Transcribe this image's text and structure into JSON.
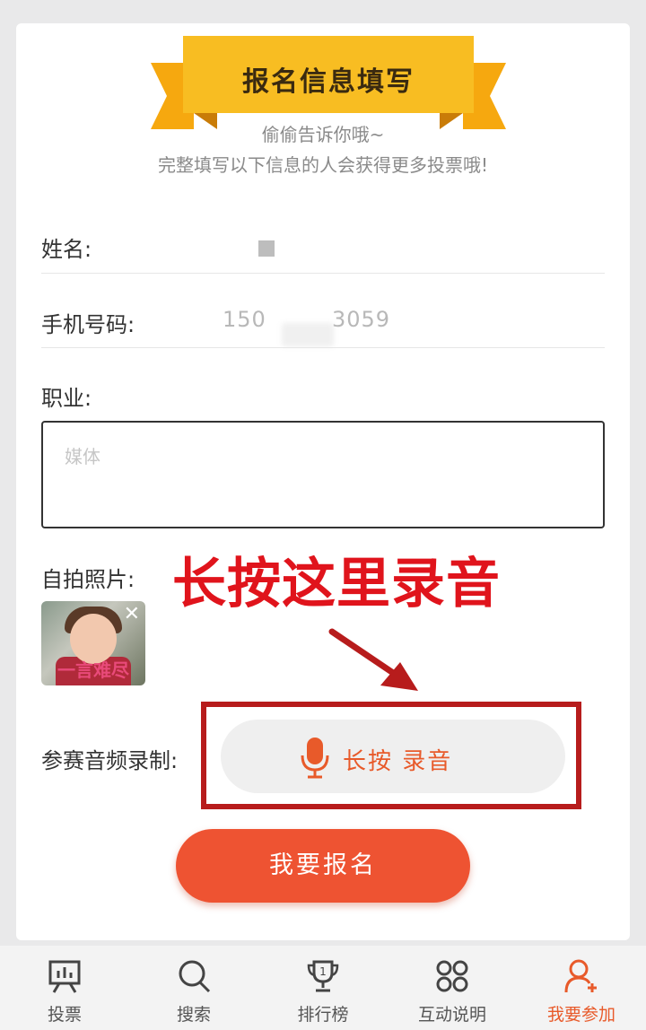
{
  "form": {
    "ribbon_title": "报名信息填写",
    "subtitle_1": "偷偷告诉你哦~",
    "subtitle_2": "完整填写以下信息的人会获得更多投票哦!",
    "name_label": "姓名:",
    "phone_label": "手机号码:",
    "phone_prefix": "150",
    "phone_suffix": "3059",
    "job_label": "职业:",
    "job_value": "媒体",
    "photo_label": "自拍照片:",
    "photo_caption": "一言难尽",
    "audio_label": "参赛音频录制:",
    "record_button": "长按 录音",
    "submit_button": "我要报名"
  },
  "overlay": {
    "annotation": "长按这里录音"
  },
  "tabbar": {
    "tabs": [
      {
        "label": "投票",
        "icon": "vote-board-icon",
        "active": false
      },
      {
        "label": "搜索",
        "icon": "search-icon",
        "active": false
      },
      {
        "label": "排行榜",
        "icon": "trophy-icon",
        "active": false
      },
      {
        "label": "互动说明",
        "icon": "interaction-grid-icon",
        "active": false
      },
      {
        "label": "我要参加",
        "icon": "add-user-icon",
        "active": true
      }
    ]
  },
  "colors": {
    "ribbon": "#f6b51a",
    "accent": "#ee5332",
    "annotation_red": "#e0141c",
    "frame_red": "#b71c1c",
    "active_tab": "#e85a2a"
  }
}
